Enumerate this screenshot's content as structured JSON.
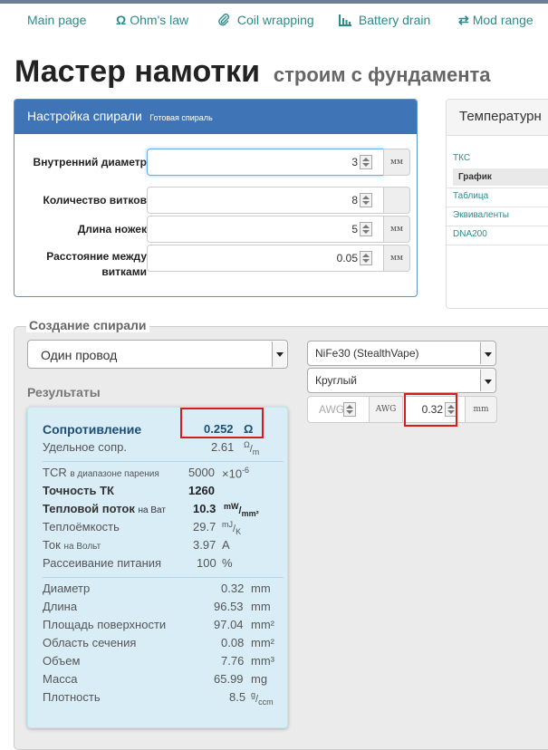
{
  "nav": {
    "items": [
      {
        "label": "Main page",
        "icon": ""
      },
      {
        "label": "Ohm's law",
        "icon": "omega-icon"
      },
      {
        "label": "Coil wrapping",
        "icon": "paperclip-icon"
      },
      {
        "label": "Battery drain",
        "icon": "bar-chart-icon"
      },
      {
        "label": "Mod range",
        "icon": "swap-icon"
      }
    ]
  },
  "page": {
    "title": "Мастер намотки",
    "subtitle": "строим с фундамента"
  },
  "coil_setup": {
    "title": "Настройка спирали",
    "subtitle": "Готовая спираль",
    "fields": [
      {
        "label": "Внутренний диаметр",
        "value": "3",
        "unit": "мм"
      },
      {
        "label": "Количество витков",
        "value": "8",
        "unit": ""
      },
      {
        "label": "Длина ножек",
        "value": "5",
        "unit": "мм"
      },
      {
        "label": "Расстояние между витками",
        "value": "0.05",
        "unit": "мм"
      }
    ]
  },
  "temp_panel": {
    "title": "Температурн",
    "items": [
      "ТКС",
      "График",
      "Таблица",
      "Эквиваленты",
      "DNA200"
    ]
  },
  "create": {
    "legend": "Создание спирали",
    "wire_type": "Один провод",
    "material": "NiFe30 (StealthVape)",
    "profile": "Круглый",
    "awg_placeholder": "AWG",
    "awg_unit": "AWG",
    "diameter_value": "0.32",
    "diameter_unit": "mm"
  },
  "results": {
    "title": "Результаты",
    "resistance": {
      "label": "Сопротивление",
      "value": "0.252",
      "unit": "Ω"
    },
    "specific": {
      "label": "Удельное сопр.",
      "value": "2.61",
      "unit_num": "Ω",
      "unit_den": "m"
    },
    "tcr": {
      "label": "TCR",
      "label_small": "в диапазоне парения",
      "value": "5000",
      "unit": "×10",
      "unit_exp": "-6"
    },
    "tc_accuracy": {
      "label": "Точность ТК",
      "value": "1260"
    },
    "heat_flux": {
      "label": "Тепловой поток",
      "label_small": "на Ват",
      "value": "10.3",
      "unit_num": "mW",
      "unit_den": "mm²"
    },
    "heat_capacity": {
      "label": "Теплоёмкость",
      "value": "29.7",
      "unit_num": "mJ",
      "unit_den": "K"
    },
    "current": {
      "label": "Ток",
      "label_small": "на Вольт",
      "value": "3.97",
      "unit": "A"
    },
    "dissipation": {
      "label": "Рассеивание питания",
      "value": "100",
      "unit": "%"
    },
    "physical": [
      {
        "label": "Диаметр",
        "value": "0.32",
        "unit": "mm"
      },
      {
        "label": "Длина",
        "value": "96.53",
        "unit": "mm"
      },
      {
        "label": "Площадь поверхности",
        "value": "97.04",
        "unit": "mm²"
      },
      {
        "label": "Область сечения",
        "value": "0.08",
        "unit": "mm²"
      },
      {
        "label": "Объем",
        "value": "7.76",
        "unit": "mm³"
      },
      {
        "label": "Масса",
        "value": "65.99",
        "unit": "mg"
      }
    ],
    "density": {
      "label": "Плотность",
      "value": "8.5",
      "unit_num": "g",
      "unit_den": "ccm"
    }
  },
  "colors": {
    "accent": "#3f74b7",
    "link": "#2b8c8a",
    "highlight": "#d61c1c",
    "results_bg": "#d9edf7"
  }
}
